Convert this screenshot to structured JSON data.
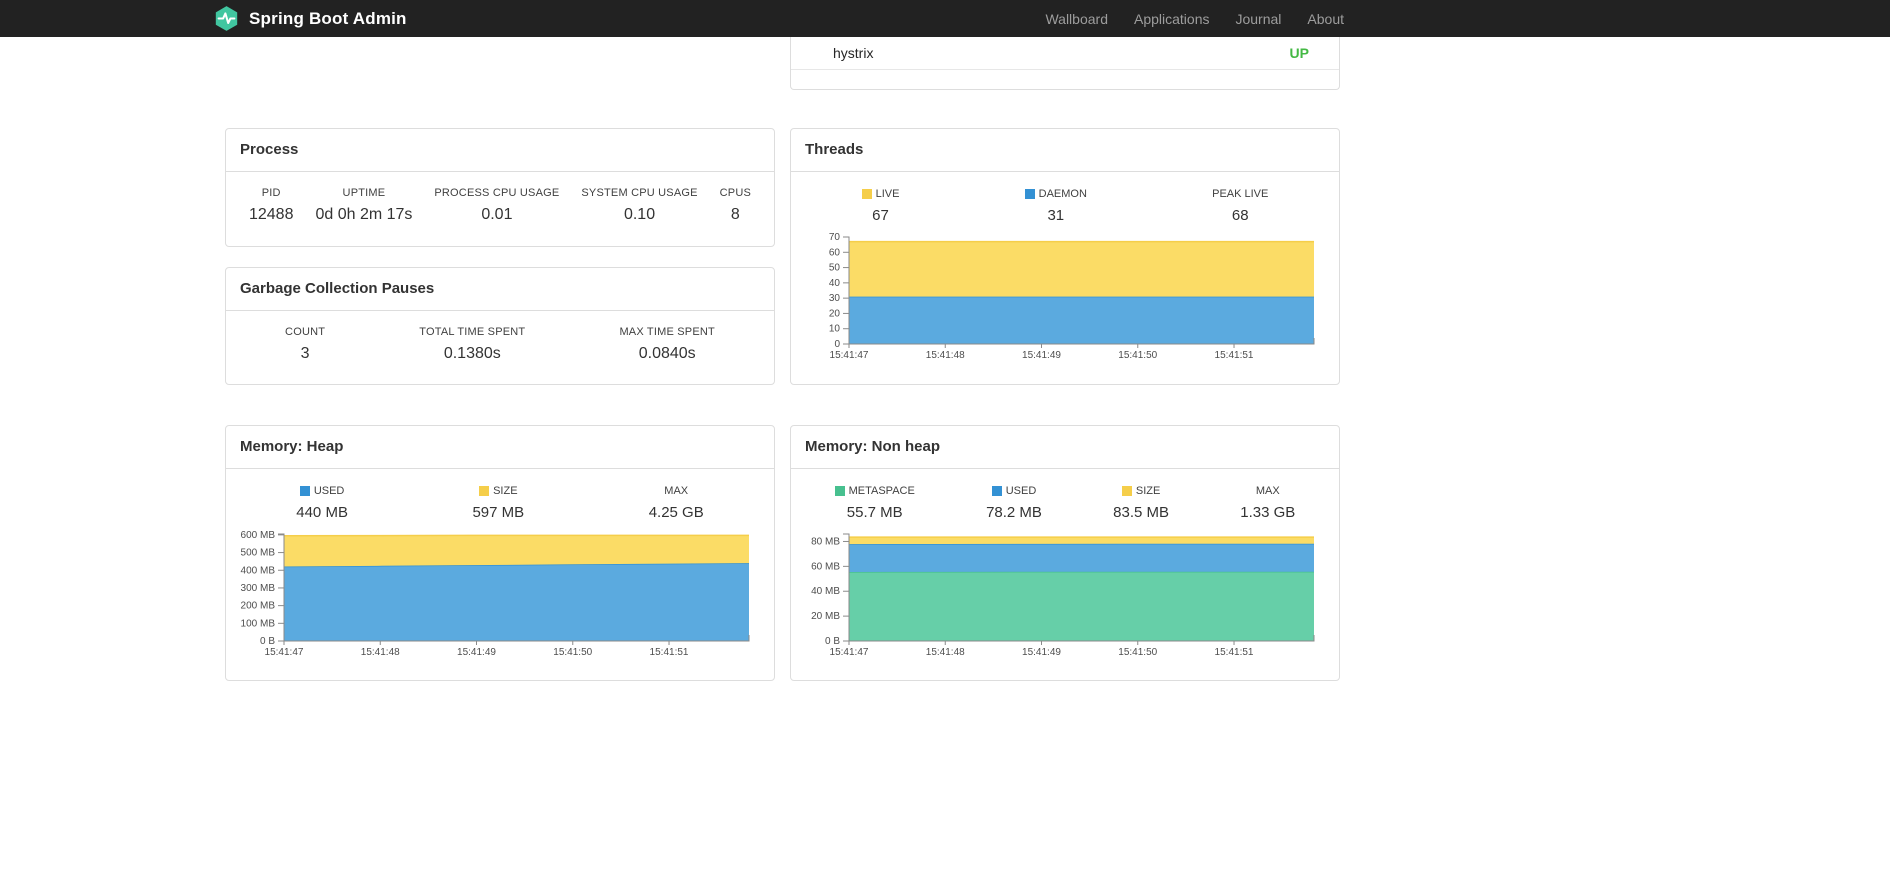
{
  "navbar": {
    "brand": "Spring Boot Admin",
    "brand_color": "#41C6A0",
    "links": [
      "Wallboard",
      "Applications",
      "Journal",
      "About"
    ]
  },
  "colors": {
    "blue": "#3391D4",
    "blue_fill": "#5BAADF",
    "yellow": "#F5CE4A",
    "yellow_fill": "#FBDC66",
    "green": "#47C08F",
    "green_fill": "#66CFA8",
    "status_up": "#44B944"
  },
  "applications_panel": {
    "rows": [
      {
        "name": "hystrix",
        "status": "UP",
        "status_color": "#44B944"
      }
    ]
  },
  "cards": {
    "process": {
      "title": "Process",
      "metrics": [
        {
          "label": "PID",
          "value": "12488"
        },
        {
          "label": "UPTIME",
          "value": "0d 0h 2m 17s"
        },
        {
          "label": "PROCESS CPU USAGE",
          "value": "0.01"
        },
        {
          "label": "SYSTEM CPU USAGE",
          "value": "0.10"
        },
        {
          "label": "CPUS",
          "value": "8"
        }
      ]
    },
    "gc": {
      "title": "Garbage Collection Pauses",
      "metrics": [
        {
          "label": "COUNT",
          "value": "3"
        },
        {
          "label": "TOTAL TIME SPENT",
          "value": "0.1380s"
        },
        {
          "label": "MAX TIME SPENT",
          "value": "0.0840s"
        }
      ]
    },
    "threads": {
      "title": "Threads",
      "legend": [
        {
          "label": "LIVE",
          "value": "67",
          "swatch": "#F5CE4A"
        },
        {
          "label": "DAEMON",
          "value": "31",
          "swatch": "#3391D4"
        },
        {
          "label": "PEAK LIVE",
          "value": "68",
          "swatch": null
        }
      ]
    },
    "heap": {
      "title": "Memory: Heap",
      "legend": [
        {
          "label": "USED",
          "value": "440 MB",
          "swatch": "#3391D4"
        },
        {
          "label": "SIZE",
          "value": "597 MB",
          "swatch": "#F5CE4A"
        },
        {
          "label": "MAX",
          "value": "4.25 GB",
          "swatch": null
        }
      ]
    },
    "nonheap": {
      "title": "Memory: Non heap",
      "legend": [
        {
          "label": "METASPACE",
          "value": "55.7 MB",
          "swatch": "#47C08F"
        },
        {
          "label": "USED",
          "value": "78.2 MB",
          "swatch": "#3391D4"
        },
        {
          "label": "SIZE",
          "value": "83.5 MB",
          "swatch": "#F5CE4A"
        },
        {
          "label": "MAX",
          "value": "1.33 GB",
          "swatch": null
        }
      ]
    }
  },
  "chart_data": [
    {
      "id": "threads",
      "type": "area",
      "title": "Threads",
      "stacked": true,
      "x": [
        "15:41:47",
        "15:41:48",
        "15:41:49",
        "15:41:50",
        "15:41:51"
      ],
      "series": [
        {
          "name": "DAEMON",
          "color": "#3391D4",
          "fill": "#5BAADF",
          "values": [
            31,
            31,
            31,
            31,
            31,
            31
          ]
        },
        {
          "name": "LIVE",
          "color": "#F5CE4A",
          "fill": "#FBDC66",
          "values": [
            67,
            67,
            67,
            67,
            67,
            67
          ]
        }
      ],
      "xlabel": "",
      "ylabel": "",
      "ylim": [
        0,
        70
      ],
      "yticks": [
        0,
        10,
        20,
        30,
        40,
        50,
        60,
        70
      ],
      "ytick_labels": [
        "0",
        "10",
        "20",
        "30",
        "40",
        "50",
        "60",
        "70"
      ],
      "grid": false,
      "legend_position": "top",
      "xtick_spacing_fraction": 0.207
    },
    {
      "id": "heap",
      "type": "area",
      "title": "Memory: Heap",
      "stacked": true,
      "x": [
        "15:41:47",
        "15:41:48",
        "15:41:49",
        "15:41:50",
        "15:41:51"
      ],
      "series": [
        {
          "name": "USED",
          "color": "#3391D4",
          "fill": "#5BAADF",
          "values": [
            421,
            425,
            429,
            433,
            437,
            440
          ]
        },
        {
          "name": "SIZE",
          "color": "#F5CE4A",
          "fill": "#FBDC66",
          "values": [
            595,
            596,
            597,
            597,
            597,
            597
          ]
        }
      ],
      "xlabel": "",
      "ylabel": "",
      "ylim": [
        0,
        605
      ],
      "yticks": [
        0,
        100,
        200,
        300,
        400,
        500,
        600
      ],
      "ytick_labels": [
        "0 B",
        "100 MB",
        "200 MB",
        "300 MB",
        "400 MB",
        "500 MB",
        "600 MB"
      ],
      "grid": false,
      "legend_position": "top",
      "xtick_spacing_fraction": 0.207
    },
    {
      "id": "nonheap",
      "type": "area",
      "title": "Memory: Non heap",
      "stacked": true,
      "x": [
        "15:41:47",
        "15:41:48",
        "15:41:49",
        "15:41:50",
        "15:41:51"
      ],
      "series": [
        {
          "name": "METASPACE",
          "color": "#47C08F",
          "fill": "#66CFA8",
          "values": [
            55.5,
            55.6,
            55.7,
            55.7,
            55.7,
            55.7
          ]
        },
        {
          "name": "USED",
          "color": "#3391D4",
          "fill": "#5BAADF",
          "values": [
            77.9,
            78.0,
            78.1,
            78.2,
            78.2,
            78.2
          ]
        },
        {
          "name": "SIZE",
          "color": "#F5CE4A",
          "fill": "#FBDC66",
          "values": [
            83.5,
            83.5,
            83.5,
            83.5,
            83.5,
            83.5
          ]
        }
      ],
      "xlabel": "",
      "ylabel": "",
      "ylim": [
        0,
        86
      ],
      "yticks": [
        0,
        20,
        40,
        60,
        80
      ],
      "ytick_labels": [
        "0 B",
        "20 MB",
        "40 MB",
        "60 MB",
        "80 MB"
      ],
      "grid": false,
      "legend_position": "top",
      "xtick_spacing_fraction": 0.207
    }
  ]
}
